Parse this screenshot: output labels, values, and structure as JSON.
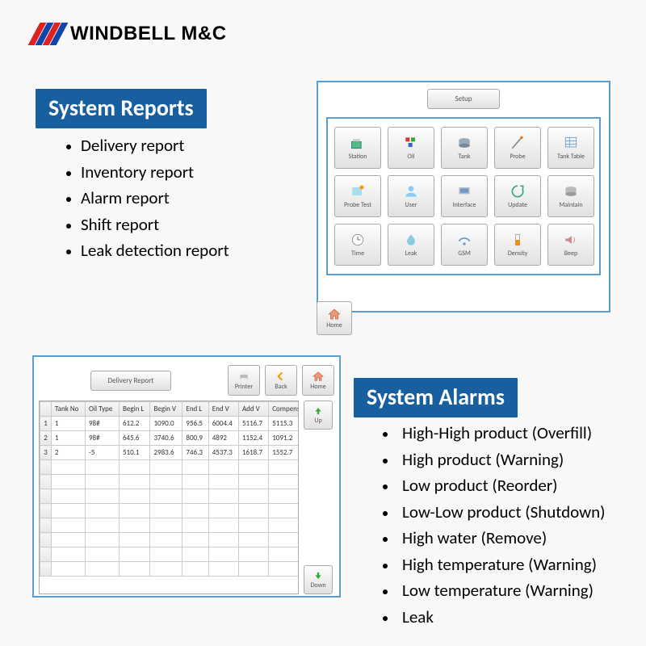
{
  "logo": {
    "text": "WINDBELL M&C"
  },
  "reports": {
    "title": "System Reports",
    "items": [
      "Delivery report",
      "Inventory report",
      "Alarm report",
      "Shift report",
      "Leak detection report"
    ]
  },
  "alarms": {
    "title": "System Alarms",
    "items": [
      "High-High product (Overfill)",
      "High product (Warning)",
      "Low product (Reorder)",
      "Low-Low product (Shutdown)",
      "High water (Remove)",
      "High temperature (Warning)",
      "Low temperature (Warning)",
      "Leak"
    ]
  },
  "setup": {
    "header": "Setup",
    "tiles": [
      "Station",
      "Oil",
      "Tank",
      "Probe",
      "Tank Table",
      "Probe Test",
      "User",
      "Interface",
      "Update",
      "Maintain",
      "Time",
      "Leak",
      "GSM",
      "Density",
      "Beep"
    ],
    "home": "Home"
  },
  "delivery": {
    "title": "Delivery Report",
    "tools": {
      "printer": "Printer",
      "back": "Back",
      "home": "Home"
    },
    "side": {
      "up": "Up",
      "down": "Down"
    },
    "columns": [
      "Tank No",
      "Oil Type",
      "Begin L",
      "Begin V",
      "End L",
      "End V",
      "Add V",
      "Compensate V"
    ],
    "rows": [
      {
        "n": "1",
        "c": [
          "1",
          "98#",
          "612.2",
          "1090.0",
          "956.5",
          "6004.4",
          "5116.7",
          "5115.3"
        ]
      },
      {
        "n": "2",
        "c": [
          "1",
          "98#",
          "645.6",
          "3740.6",
          "800.9",
          "4892",
          "1152.4",
          "1091.2"
        ]
      },
      {
        "n": "3",
        "c": [
          "2",
          "-5",
          "510.1",
          "2983.6",
          "746.3",
          "4537.3",
          "1618.7",
          "1552.7"
        ]
      }
    ]
  }
}
